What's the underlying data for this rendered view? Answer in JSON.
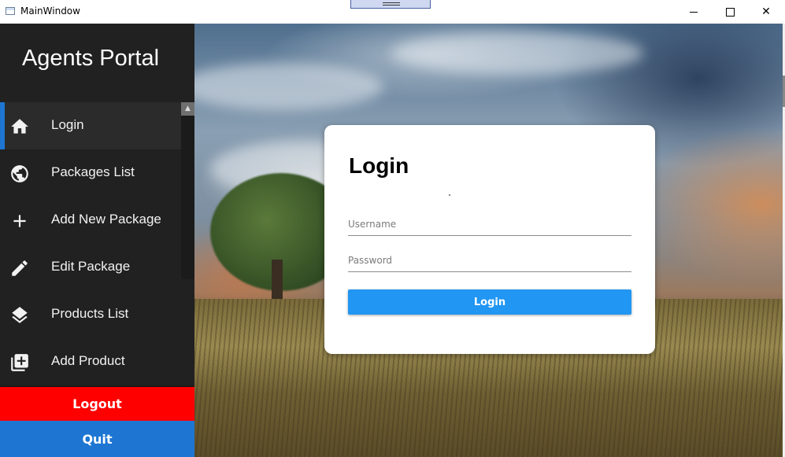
{
  "window": {
    "title": "MainWindow",
    "minimize_glyph": "",
    "maximize_glyph": "",
    "close_glyph": "✕"
  },
  "sidebar": {
    "brand": "Agents Portal",
    "items": [
      {
        "label": "Login",
        "icon": "home-icon",
        "active": true
      },
      {
        "label": "Packages List",
        "icon": "globe-icon",
        "active": false
      },
      {
        "label": "Add New Package",
        "icon": "plus-icon",
        "active": false
      },
      {
        "label": "Edit Package",
        "icon": "pencil-icon",
        "active": false
      },
      {
        "label": "Products List",
        "icon": "layers-icon",
        "active": false
      },
      {
        "label": "Add Product",
        "icon": "add-box-icon",
        "active": false
      }
    ],
    "logout_label": "Logout",
    "quit_label": "Quit"
  },
  "login_card": {
    "title": "Login",
    "username_placeholder": "Username",
    "password_placeholder": "Password",
    "submit_label": "Login"
  },
  "colors": {
    "sidebar_bg": "#212121",
    "accent_blue": "#1e76d2",
    "button_blue": "#2196f3",
    "logout_red": "#ff0000"
  }
}
